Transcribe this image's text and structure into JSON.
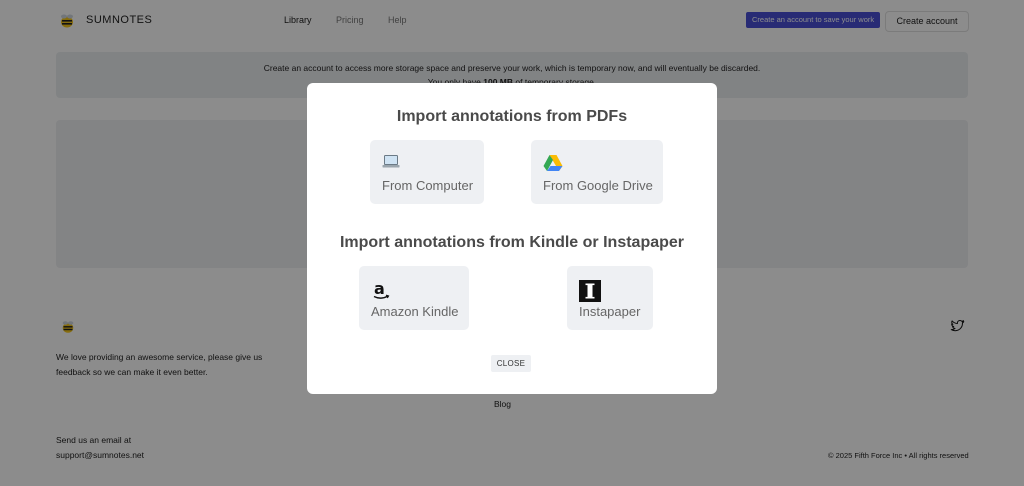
{
  "header": {
    "brand": "SUMNOTES",
    "nav": [
      "Library",
      "Pricing",
      "Help"
    ],
    "cta_badge": "Create an account to save your work",
    "create_account": "Create account"
  },
  "banner": {
    "line1": "Create an account to access more storage space and preserve your work, which is temporary now, and will eventually be discarded.",
    "line2_prefix": "You only have",
    "line2_bold": "100 MB",
    "line2_suffix": "of temporary storage."
  },
  "footer": {
    "tagline_1": "We love providing an awesome service, please give us",
    "tagline_2": "feedback so we can make it even better.",
    "blog": "Blog",
    "email_label": "Send us an email at",
    "email": "support@sumnotes.net",
    "copyright": "© 2025 Fifth Force Inc • All rights reserved"
  },
  "modal": {
    "pdf_title": "Import annotations from PDFs",
    "from_computer": "From Computer",
    "from_google_drive": "From Google Drive",
    "kindle_title": "Import annotations from Kindle or Instapaper",
    "amazon_kindle": "Amazon Kindle",
    "instapaper": "Instapaper",
    "close": "CLOSE"
  },
  "icons": {
    "logo": "bee-logo-icon",
    "computer": "laptop-icon",
    "drive": "google-drive-icon",
    "amazon": "amazon-icon",
    "instapaper": "instapaper-icon",
    "twitter": "twitter-icon"
  },
  "colors": {
    "cta_badge_bg": "#4a4fd6",
    "overlay": "rgba(0,0,0,0.45)"
  }
}
